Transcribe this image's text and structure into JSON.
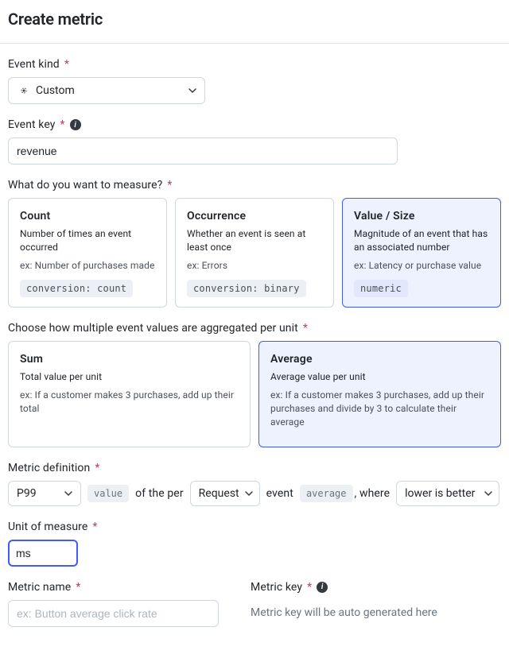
{
  "page_title": "Create metric",
  "event_kind": {
    "label": "Event kind",
    "value": "Custom"
  },
  "event_key": {
    "label": "Event key",
    "value": "revenue"
  },
  "measure": {
    "label": "What do you want to measure?",
    "options": [
      {
        "title": "Count",
        "desc": "Number of times an event occurred",
        "ex": "ex: Number of purchases made",
        "tag": "conversion: count",
        "selected": false
      },
      {
        "title": "Occurrence",
        "desc": "Whether an event is seen at least once",
        "ex": "ex: Errors",
        "tag": "conversion: binary",
        "selected": false
      },
      {
        "title": "Value / Size",
        "desc": "Magnitude of an event that has an associated number",
        "ex": "ex: Latency or purchase value",
        "tag": "numeric",
        "selected": true
      }
    ]
  },
  "aggregation": {
    "label": "Choose how multiple event values are aggregated per unit",
    "options": [
      {
        "title": "Sum",
        "desc": "Total value per unit",
        "ex": "ex: If a customer makes 3 purchases, add up their total",
        "selected": false
      },
      {
        "title": "Average",
        "desc": "Average value per unit",
        "ex": "ex: If a customer makes 3 purchases, add up their purchases and divide by 3 to calculate their average",
        "selected": true
      }
    ]
  },
  "definition": {
    "label": "Metric definition",
    "stat": "P99",
    "tag1": "value",
    "text1": "of the per",
    "unit": "Request",
    "text2": "event",
    "tag2": "average",
    "text3": ", where",
    "direction": "lower is better"
  },
  "unit_of_measure": {
    "label": "Unit of measure",
    "value": "ms"
  },
  "metric_name": {
    "label": "Metric name",
    "placeholder": "ex: Button average click rate",
    "value": ""
  },
  "metric_key": {
    "label": "Metric key",
    "placeholder": "Metric key will be auto generated here"
  }
}
